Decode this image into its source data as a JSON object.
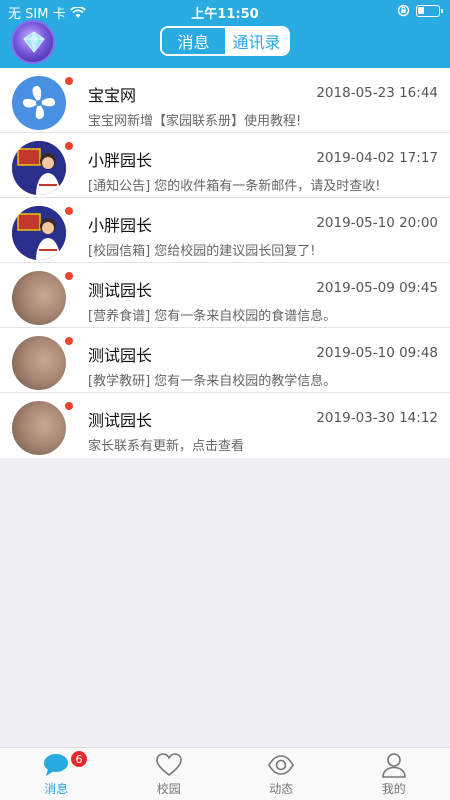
{
  "status_bar": {
    "carrier": "无 SIM 卡",
    "time": "上午11:50",
    "battery_level": 0.3
  },
  "header": {
    "tabs": [
      {
        "label": "消息",
        "active": true
      },
      {
        "label": "通讯录",
        "active": false
      }
    ]
  },
  "messages": [
    {
      "name": "宝宝网",
      "time": "2018-05-23 16:44",
      "preview": "宝宝网新增【家园联系册】使用教程!",
      "unread": true,
      "avatar": "fan-logo"
    },
    {
      "name": "小胖园长",
      "time": "2019-04-02 17:17",
      "preview": "[通知公告] 您的收件箱有一条新邮件，请及时查收!",
      "unread": true,
      "avatar": "kid-photo"
    },
    {
      "name": "小胖园长",
      "time": "2019-05-10 20:00",
      "preview": "[校园信箱] 您给校园的建议园长回复了!",
      "unread": true,
      "avatar": "kid-photo"
    },
    {
      "name": "测试园长",
      "time": "2019-05-09 09:45",
      "preview": "[营养食谱] 您有一条来自校园的食谱信息。",
      "unread": true,
      "avatar": "blur-photo"
    },
    {
      "name": "测试园长",
      "time": "2019-05-10 09:48",
      "preview": "[教学教研] 您有一条来自校园的教学信息。",
      "unread": true,
      "avatar": "blur-photo"
    },
    {
      "name": "测试园长",
      "time": "2019-03-30 14:12",
      "preview": "家长联系有更新，点击查看",
      "unread": true,
      "avatar": "blur-photo"
    }
  ],
  "tabbar": {
    "items": [
      {
        "label": "消息",
        "icon": "chat-bubble-icon",
        "active": true,
        "badge": "6"
      },
      {
        "label": "校园",
        "icon": "heart-icon",
        "active": false
      },
      {
        "label": "动态",
        "icon": "eye-icon",
        "active": false
      },
      {
        "label": "我的",
        "icon": "person-icon",
        "active": false
      }
    ]
  },
  "colors": {
    "accent": "#29aae1",
    "unread_dot": "#f0442a",
    "badge": "#e8282b"
  }
}
